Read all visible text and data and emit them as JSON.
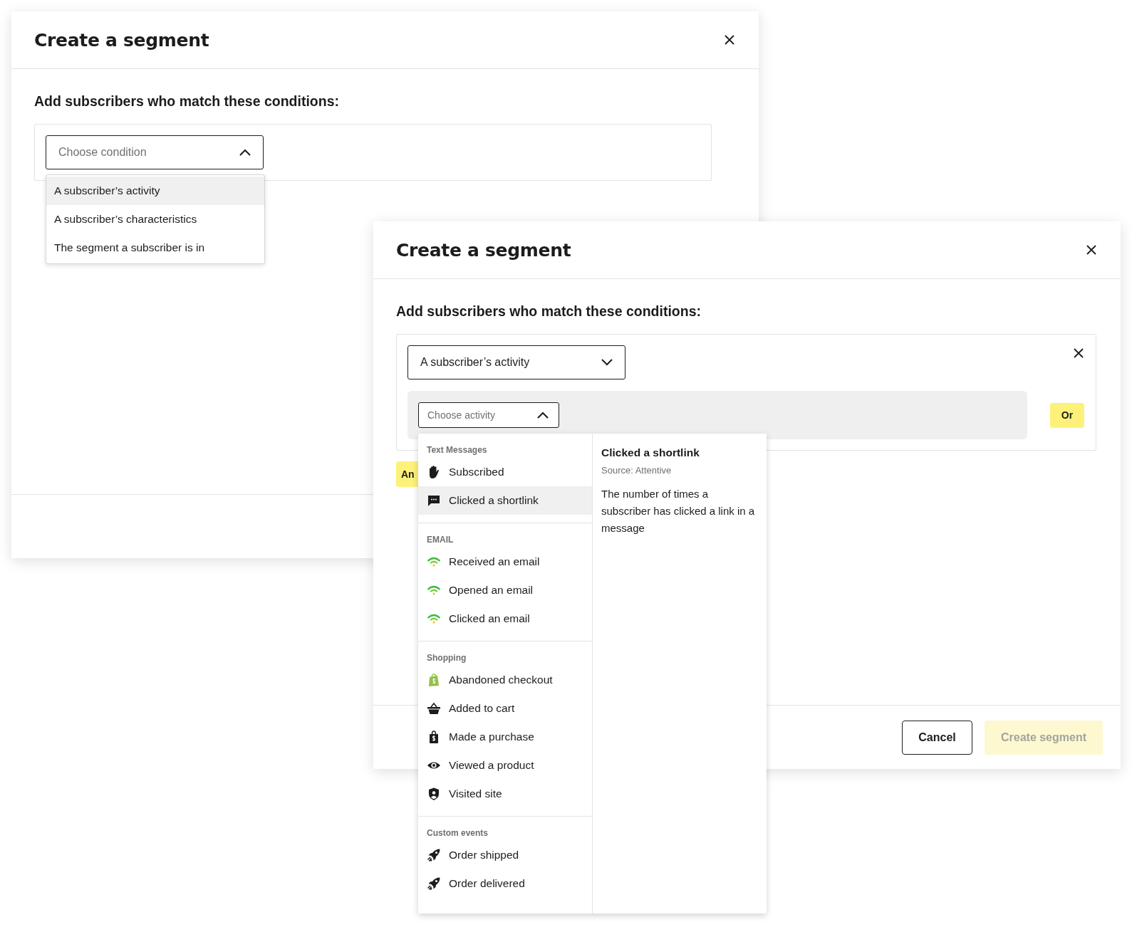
{
  "back_dialog": {
    "title": "Create a segment",
    "heading": "Add subscribers who match these conditions:",
    "condition_select": {
      "placeholder": "Choose condition",
      "expanded": true
    },
    "condition_menu": [
      {
        "label": "A subscriber’s activity",
        "selected": true
      },
      {
        "label": "A subscriber’s characteristics",
        "selected": false
      },
      {
        "label": "The segment a subscriber is in",
        "selected": false
      }
    ]
  },
  "front_dialog": {
    "title": "Create a segment",
    "heading": "Add subscribers who match these conditions:",
    "condition_select": {
      "value": "A subscriber’s activity",
      "expanded": false
    },
    "activity_select": {
      "placeholder": "Choose activity",
      "expanded": true
    },
    "or_button": "Or",
    "and_button": "An",
    "activity_menu": [
      {
        "title": "Text Messages",
        "items": [
          {
            "label": "Subscribed",
            "kind": "subscribed",
            "selected": false
          },
          {
            "label": "Clicked a shortlink",
            "kind": "shortlink",
            "selected": true
          }
        ]
      },
      {
        "title": "EMAIL",
        "items": [
          {
            "label": "Received an email",
            "kind": "email",
            "selected": false
          },
          {
            "label": "Opened an email",
            "kind": "email",
            "selected": false
          },
          {
            "label": "Clicked an email",
            "kind": "email",
            "selected": false
          }
        ]
      },
      {
        "title": "Shopping",
        "items": [
          {
            "label": "Abandoned checkout",
            "kind": "checkout",
            "selected": false
          },
          {
            "label": "Added to cart",
            "kind": "cart",
            "selected": false
          },
          {
            "label": "Made a purchase",
            "kind": "purchase",
            "selected": false
          },
          {
            "label": "Viewed a product",
            "kind": "view",
            "selected": false
          },
          {
            "label": "Visited site",
            "kind": "visit",
            "selected": false
          }
        ]
      },
      {
        "title": "Custom events",
        "items": [
          {
            "label": "Order shipped",
            "kind": "custom",
            "selected": false
          },
          {
            "label": "Order delivered",
            "kind": "custom",
            "selected": false
          }
        ]
      }
    ],
    "detail": {
      "title": "Clicked a shortlink",
      "source": "Source: Attentive",
      "description": "The number of times a subscriber has clicked a link in a message"
    },
    "buttons": [
      {
        "label": "Cancel",
        "kind": "secondary",
        "disabled": false
      },
      {
        "label": "Create segment",
        "kind": "primary",
        "disabled": true
      }
    ]
  }
}
